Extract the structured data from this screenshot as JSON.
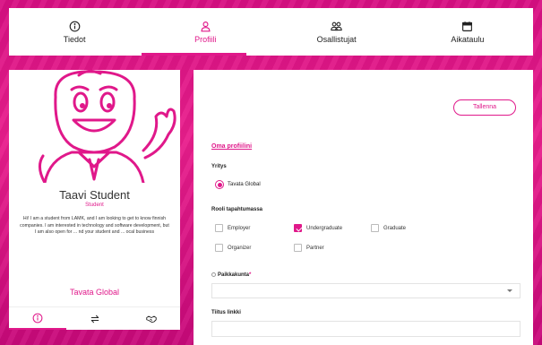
{
  "nav": {
    "tabs": [
      {
        "label": "Tiedot",
        "icon": "info-icon"
      },
      {
        "label": "Profiili",
        "icon": "person-icon",
        "active": true
      },
      {
        "label": "Osallistujat",
        "icon": "people-icon"
      },
      {
        "label": "Aikataulu",
        "icon": "calendar-icon"
      }
    ]
  },
  "profile_card": {
    "name": "Taavi Student",
    "role": "Student",
    "bio": "Hi! I am a student from LAMK, and I am looking to get to know finnish companies. I am interested in technology and software development, but I am also open for ... nd your student and ... ocal business",
    "company": "Tavata Global",
    "tab_icons": [
      "info-icon",
      "swap-arrows-icon",
      "handshake-icon"
    ]
  },
  "form": {
    "save_label": "Tallenna",
    "section_title": "Oma profiilini",
    "company_label": "Yritys",
    "company_option": "Tavata Global",
    "role_label": "Rooli tapahtumassa",
    "roles": [
      {
        "label": "Employer",
        "checked": false
      },
      {
        "label": "Undergraduate",
        "checked": true
      },
      {
        "label": "Graduate",
        "checked": false
      },
      {
        "label": "Organizer",
        "checked": false
      },
      {
        "label": "Partner",
        "checked": false
      }
    ],
    "city_label": "Paikkakunta",
    "city_required_mark": "*",
    "city_value": "",
    "link_label": "Tiitus linkki",
    "link_value": ""
  },
  "colors": {
    "accent": "#e0188a",
    "text": "#222222"
  }
}
